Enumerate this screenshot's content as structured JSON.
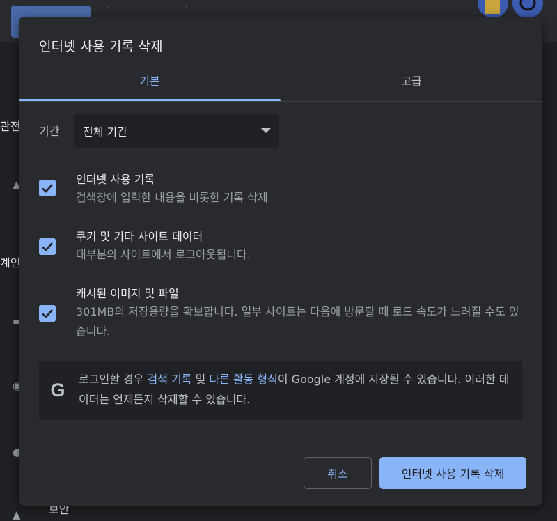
{
  "background": {
    "side_texts": [
      "관전",
      "계인",
      "보안"
    ]
  },
  "dialog": {
    "title": "인터넷 사용 기록 삭제",
    "tabs": [
      {
        "label": "기본",
        "selected": true
      },
      {
        "label": "고급",
        "selected": false
      }
    ],
    "period": {
      "label": "기간",
      "value": "전체 기간"
    },
    "items": [
      {
        "title": "인터넷 사용 기록",
        "desc": "검색창에 입력한 내용을 비롯한 기록 삭제",
        "checked": true
      },
      {
        "title": "쿠키 및 기타 사이트 데이터",
        "desc": "대부분의 사이트에서 로그아웃됩니다.",
        "checked": true
      },
      {
        "title": "캐시된 이미지 및 파일",
        "desc": "301MB의 저장용량을 확보합니다. 일부 사이트는 다음에 방문할 때 로드 속도가 느려질 수도 있습니다.",
        "checked": true
      }
    ],
    "info": {
      "icon": "google-g-icon",
      "prefix": "로그인할 경우 ",
      "link1": "검색 기록",
      "mid": " 및 ",
      "link2": "다른 활동 형식",
      "suffix": "이 Google 계정에 저장될 수 있습니다. 이러한 데이터는 언제든지 삭제할 수 있습니다."
    },
    "buttons": {
      "cancel": "취소",
      "confirm": "인터넷 사용 기록 삭제"
    }
  },
  "colors": {
    "accent": "#8ab4f8",
    "dialog_bg": "#292a2d",
    "panel_bg": "#202124"
  }
}
